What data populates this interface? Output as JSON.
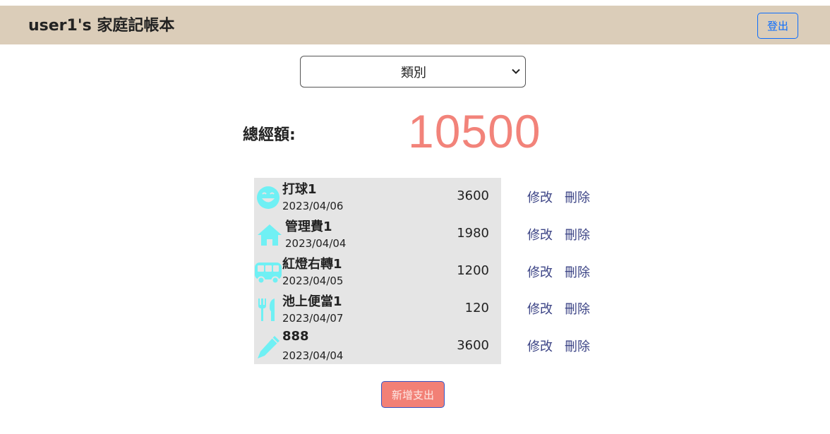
{
  "header": {
    "title": "user1's 家庭記帳本",
    "logout_label": "登出"
  },
  "filter": {
    "selected": "類別"
  },
  "summary": {
    "total_label": "總經額:",
    "total_value": "10500"
  },
  "expenses": [
    {
      "icon": "smile-icon",
      "name": "打球1",
      "date": "2023/04/06",
      "amount": "3600",
      "edit": "修改",
      "delete": "刪除"
    },
    {
      "icon": "home-icon",
      "name": "管理費1",
      "date": "2023/04/04",
      "amount": "1980",
      "edit": "修改",
      "delete": "刪除"
    },
    {
      "icon": "bus-icon",
      "name": "紅燈右轉1",
      "date": "2023/04/05",
      "amount": "1200",
      "edit": "修改",
      "delete": "刪除"
    },
    {
      "icon": "utensils-icon",
      "name": "池上便當1",
      "date": "2023/04/07",
      "amount": "120",
      "edit": "修改",
      "delete": "刪除"
    },
    {
      "icon": "pen-icon",
      "name": "888",
      "date": "2023/04/04",
      "amount": "3600",
      "edit": "修改",
      "delete": "刪除"
    }
  ],
  "add_button_label": "新增支出",
  "colors": {
    "header_bg": "#dbcdb9",
    "total": "#f2837a",
    "icon": "#6ff0f4",
    "action_link": "#3b4385",
    "add_button": "#f28076"
  }
}
